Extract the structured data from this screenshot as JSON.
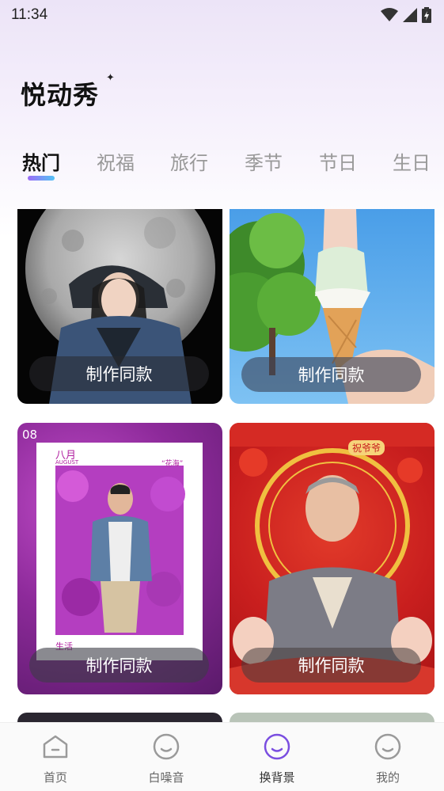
{
  "status_bar": {
    "time": "11:34"
  },
  "app": {
    "title": "悦动秀"
  },
  "tabs": [
    {
      "label": "热门",
      "active": true
    },
    {
      "label": "祝福"
    },
    {
      "label": "旅行"
    },
    {
      "label": "季节"
    },
    {
      "label": "节日"
    },
    {
      "label": "生日"
    }
  ],
  "cards": [
    {
      "button": "制作同款",
      "theme": "moon"
    },
    {
      "button": "制作同款",
      "theme": "ice-cream"
    },
    {
      "button": "制作同款",
      "theme": "flowers",
      "overlay": {
        "date": "08",
        "month": "八月",
        "month_en": "AUGUST",
        "tag": "“花海”",
        "caption": "生活"
      }
    },
    {
      "button": "制作同款",
      "theme": "blessing",
      "overlay": {
        "banner": "祝爷爷"
      }
    }
  ],
  "bottom_nav": [
    {
      "label": "首页",
      "icon": "home-icon"
    },
    {
      "label": "白噪音",
      "icon": "smile-icon"
    },
    {
      "label": "换背景",
      "icon": "smile-icon",
      "active": true
    },
    {
      "label": "我的",
      "icon": "smile-icon"
    }
  ],
  "colors": {
    "accent": "#7a4ee0",
    "tab_gradient_start": "#9b6cf6",
    "tab_gradient_end": "#55c3f5"
  }
}
